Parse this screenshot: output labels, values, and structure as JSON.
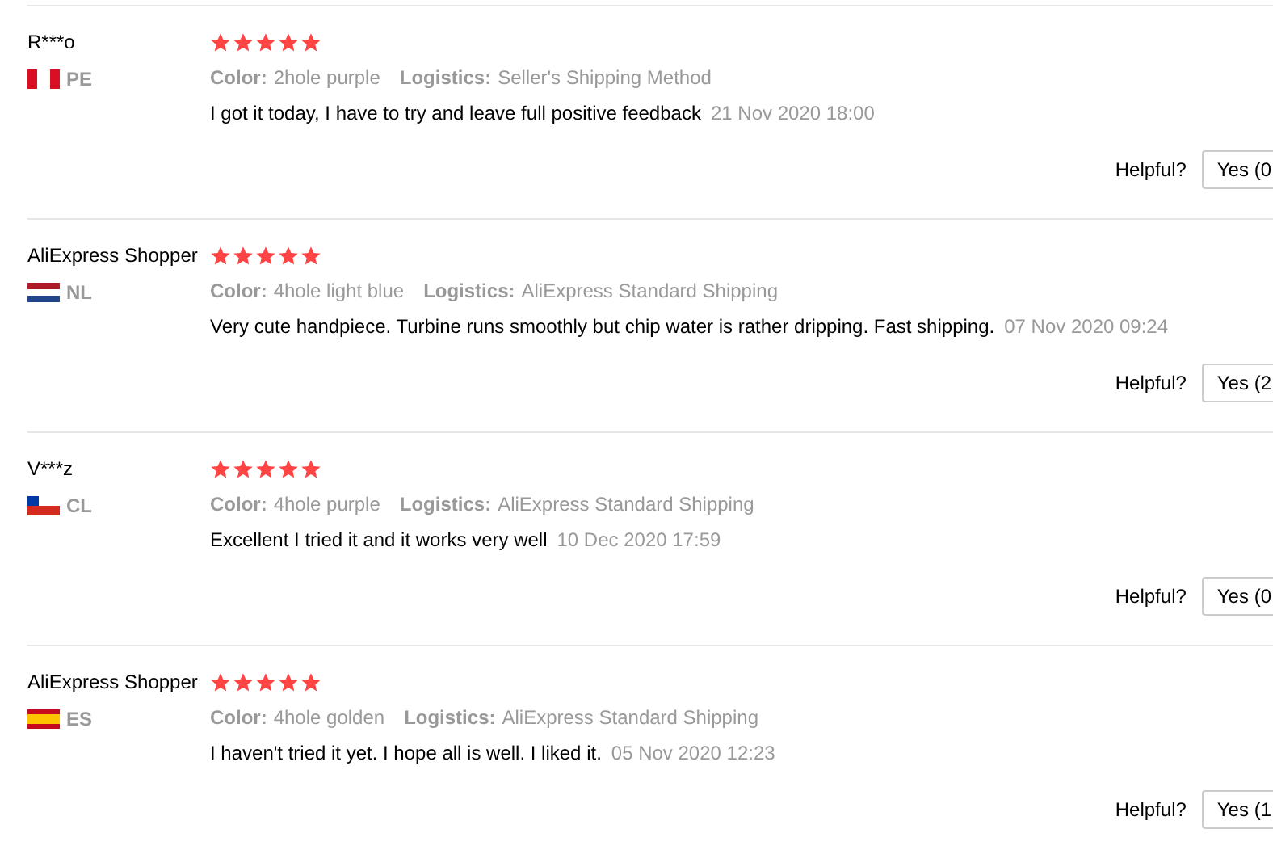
{
  "reviews": [
    {
      "name": "R***o",
      "country": "PE",
      "flag": {
        "kind": "pe"
      },
      "stars": 5,
      "color_label": "Color:",
      "variant": "2hole purple",
      "logistics_label": "Logistics:",
      "logistics": "Seller's Shipping Method",
      "text": "I got it today, I have to try and leave full positive feedback",
      "date": "21 Nov 2020 18:00",
      "helpful_label": "Helpful?",
      "yes_button": "Yes (0"
    },
    {
      "name": "AliExpress Shopper",
      "country": "NL",
      "flag": {
        "kind": "nl"
      },
      "stars": 5,
      "color_label": "Color:",
      "variant": "4hole light blue",
      "logistics_label": "Logistics:",
      "logistics": "AliExpress Standard Shipping",
      "text": "Very cute handpiece. Turbine runs smoothly but chip water is rather dripping. Fast shipping.",
      "date": "07 Nov 2020 09:24",
      "helpful_label": "Helpful?",
      "yes_button": "Yes (2"
    },
    {
      "name": "V***z",
      "country": "CL",
      "flag": {
        "kind": "cl"
      },
      "stars": 5,
      "color_label": "Color:",
      "variant": "4hole purple",
      "logistics_label": "Logistics:",
      "logistics": "AliExpress Standard Shipping",
      "text": "Excellent I tried it and it works very well",
      "date": "10 Dec 2020 17:59",
      "helpful_label": "Helpful?",
      "yes_button": "Yes (0"
    },
    {
      "name": "AliExpress Shopper",
      "country": "ES",
      "flag": {
        "kind": "es"
      },
      "stars": 5,
      "color_label": "Color:",
      "variant": "4hole golden",
      "logistics_label": "Logistics:",
      "logistics": "AliExpress Standard Shipping",
      "text": "I haven't tried it yet. I hope all is well. I liked it.",
      "date": "05 Nov 2020 12:23",
      "helpful_label": "Helpful?",
      "yes_button": "Yes (1"
    }
  ]
}
